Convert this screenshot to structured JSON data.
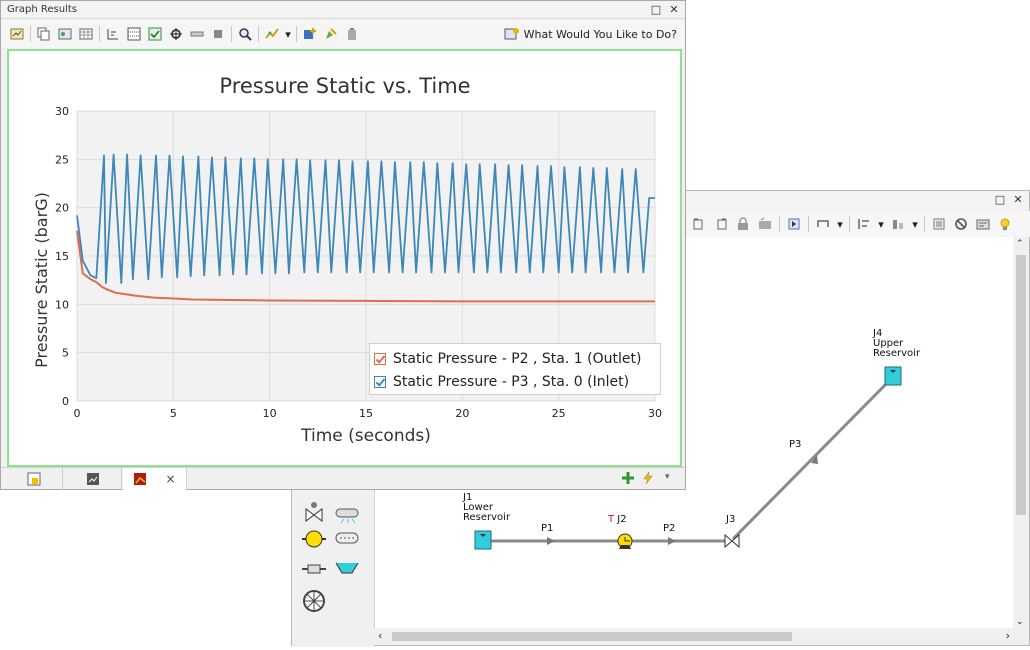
{
  "graph_window": {
    "title": "Graph Results",
    "help_label": "What Would You Like to Do?",
    "tab_close": "×"
  },
  "chart_data": {
    "type": "line",
    "title": "Pressure Static vs. Time",
    "xlabel": "Time (seconds)",
    "ylabel": "Pressure Static (barG)",
    "xlim": [
      0,
      30
    ],
    "ylim": [
      0,
      30
    ],
    "xticks": [
      0,
      5,
      10,
      15,
      20,
      25,
      30
    ],
    "yticks": [
      0,
      5,
      10,
      15,
      20,
      25,
      30
    ],
    "grid": true,
    "legend_position": "bottom-right",
    "series": [
      {
        "name": "Static Pressure - P2 , Sta. 1 (Outlet)",
        "color": "#e06c50",
        "x": [
          0,
          0.3,
          0.7,
          1.0,
          1.3,
          1.6,
          2,
          3,
          4,
          5,
          6,
          8,
          10,
          15,
          20,
          25,
          30
        ],
        "y": [
          17.6,
          13.2,
          12.6,
          12.3,
          11.8,
          11.5,
          11.2,
          10.9,
          10.7,
          10.6,
          10.5,
          10.45,
          10.4,
          10.35,
          10.3,
          10.3,
          10.3
        ]
      },
      {
        "name": "Static Pressure - P3 , Sta. 0 (Inlet)",
        "color": "#3d88b8",
        "x": [
          0,
          0.3,
          0.7,
          1.0,
          1.4,
          1.5,
          1.9,
          2.3,
          2.6,
          2.9,
          3.3,
          3.7,
          4.1,
          4.4,
          4.8,
          5.2,
          5.5,
          5.9,
          6.3,
          6.6,
          7.0,
          7.4,
          7.7,
          8.1,
          8.5,
          8.8,
          9.2,
          9.6,
          9.9,
          10.3,
          10.7,
          11.0,
          11.4,
          11.8,
          12.1,
          12.5,
          12.9,
          13.2,
          13.6,
          14.0,
          14.3,
          14.7,
          15.1,
          15.4,
          15.8,
          16.2,
          16.5,
          16.9,
          17.3,
          17.6,
          18.0,
          18.4,
          18.7,
          19.1,
          19.5,
          19.8,
          20.2,
          20.6,
          20.9,
          21.3,
          21.7,
          22.0,
          22.4,
          22.8,
          23.1,
          23.5,
          23.9,
          24.2,
          24.6,
          25.0,
          25.3,
          25.7,
          26.1,
          26.4,
          26.8,
          27.2,
          27.5,
          27.9,
          28.3,
          28.6,
          29.0,
          29.4,
          29.7,
          30.0
        ],
        "y": [
          19.2,
          14.5,
          13.0,
          12.7,
          25.4,
          12.2,
          25.5,
          12.2,
          25.5,
          12.6,
          25.4,
          12.6,
          25.4,
          12.8,
          25.4,
          12.8,
          25.3,
          12.9,
          25.3,
          13.0,
          25.2,
          13.0,
          25.2,
          13.1,
          25.1,
          13.1,
          25.1,
          13.2,
          25.0,
          13.2,
          25.0,
          13.2,
          25.0,
          13.3,
          24.9,
          13.3,
          24.9,
          13.3,
          24.9,
          13.3,
          24.8,
          13.3,
          24.8,
          13.3,
          24.8,
          13.3,
          24.7,
          13.3,
          24.7,
          13.3,
          24.7,
          13.3,
          24.6,
          13.3,
          24.6,
          13.3,
          24.5,
          13.3,
          24.5,
          13.3,
          24.5,
          13.3,
          24.4,
          13.3,
          24.4,
          13.3,
          24.3,
          13.3,
          24.3,
          13.3,
          24.2,
          13.3,
          24.2,
          13.3,
          24.1,
          13.3,
          24.1,
          13.3,
          24.0,
          13.3,
          24.0,
          13.3,
          21.0,
          21.0
        ]
      }
    ]
  },
  "network": {
    "nodes": {
      "j1": "J1\nLower\nReservoir",
      "j2_prefix": "T",
      "j2": "J2",
      "j3": "J3",
      "j4": "J4\nUpper\nReservoir"
    },
    "pipes": {
      "p1": "P1",
      "p2": "P2",
      "p3": "P3"
    }
  },
  "colors": {
    "reservoir_fill": "#33ccdd",
    "pump_fill": "#ffdd00",
    "pipe": "#8a8a8a",
    "accent_green": "#7fd67f"
  }
}
